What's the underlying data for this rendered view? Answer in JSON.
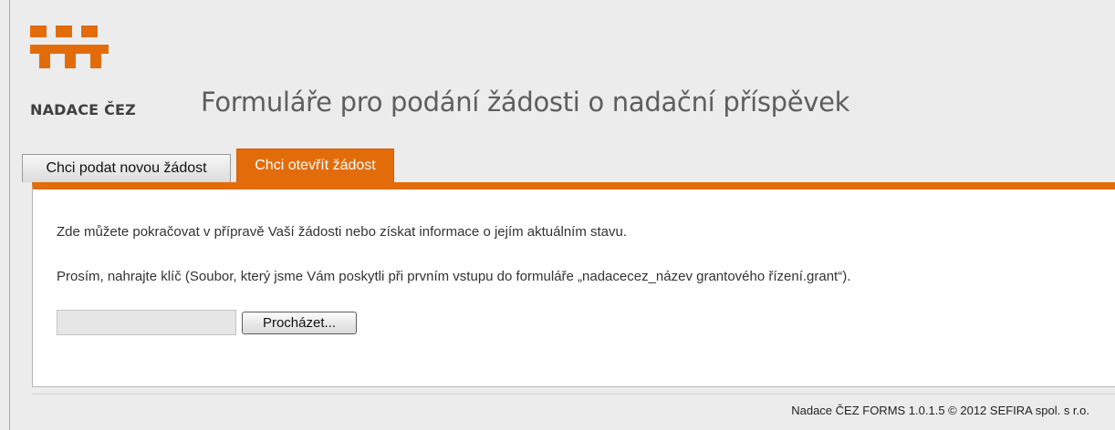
{
  "header": {
    "logo_text": "NADACE ČEZ",
    "title": "Formuláře pro podání žádosti o nadační příspěvek"
  },
  "tabs": [
    {
      "label": "Chci podat novou žádost",
      "active": false
    },
    {
      "label": "Chci otevřít žádost",
      "active": true
    }
  ],
  "main": {
    "intro": "Zde můžete pokračovat v přípravě Vaší žádosti nebo získat informace o jejím aktuálním stavu.",
    "instruction": "Prosím, nahrajte klíč (Soubor, který jsme Vám poskytli při prvním vstupu do formuláře „nadacecez_název grantového řízení.grant“).",
    "file_value": "",
    "browse_label": "Procházet..."
  },
  "footer": {
    "text": "Nadace ČEZ FORMS 1.0.1.5 © 2012 SEFIRA spol. s r.o."
  },
  "colors": {
    "accent": "#e36c0a",
    "background": "#ececec",
    "panel": "#ffffff"
  },
  "icons": {
    "logo": "nadace-cez-logo-icon"
  }
}
